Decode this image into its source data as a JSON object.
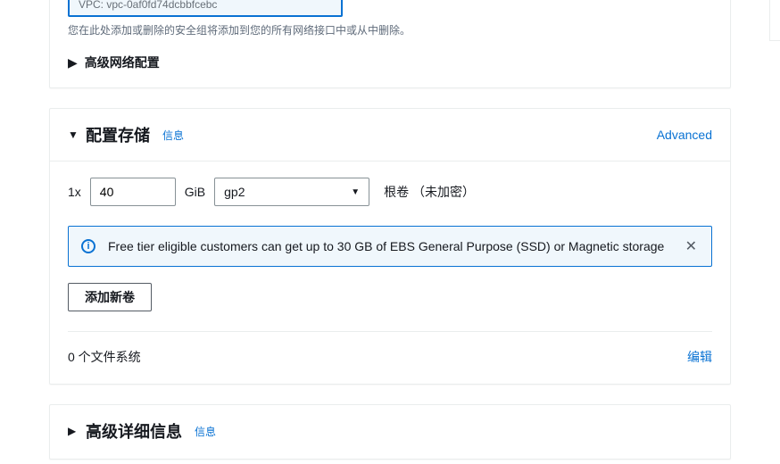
{
  "network": {
    "vpc_value": "VPC: vpc-0af0fd74dcbbfcebc",
    "hint": "您在此处添加或删除的安全组将添加到您的所有网络接口中或从中删除。",
    "advanced_label": "高级网络配置"
  },
  "storage": {
    "title": "配置存储",
    "info_label": "信息",
    "advanced_label": "Advanced",
    "count_prefix": "1x",
    "size_value": "40",
    "unit": "GiB",
    "type_value": "gp2",
    "root_label": "根卷 （未加密）",
    "free_tier_msg": "Free tier eligible customers can get up to 30 GB of EBS General Purpose (SSD) or Magnetic storage",
    "add_volume_label": "添加新卷",
    "fs_count_label": "0 个文件系统",
    "edit_label": "编辑"
  },
  "advanced_details": {
    "title": "高级详细信息",
    "info_label": "信息"
  }
}
